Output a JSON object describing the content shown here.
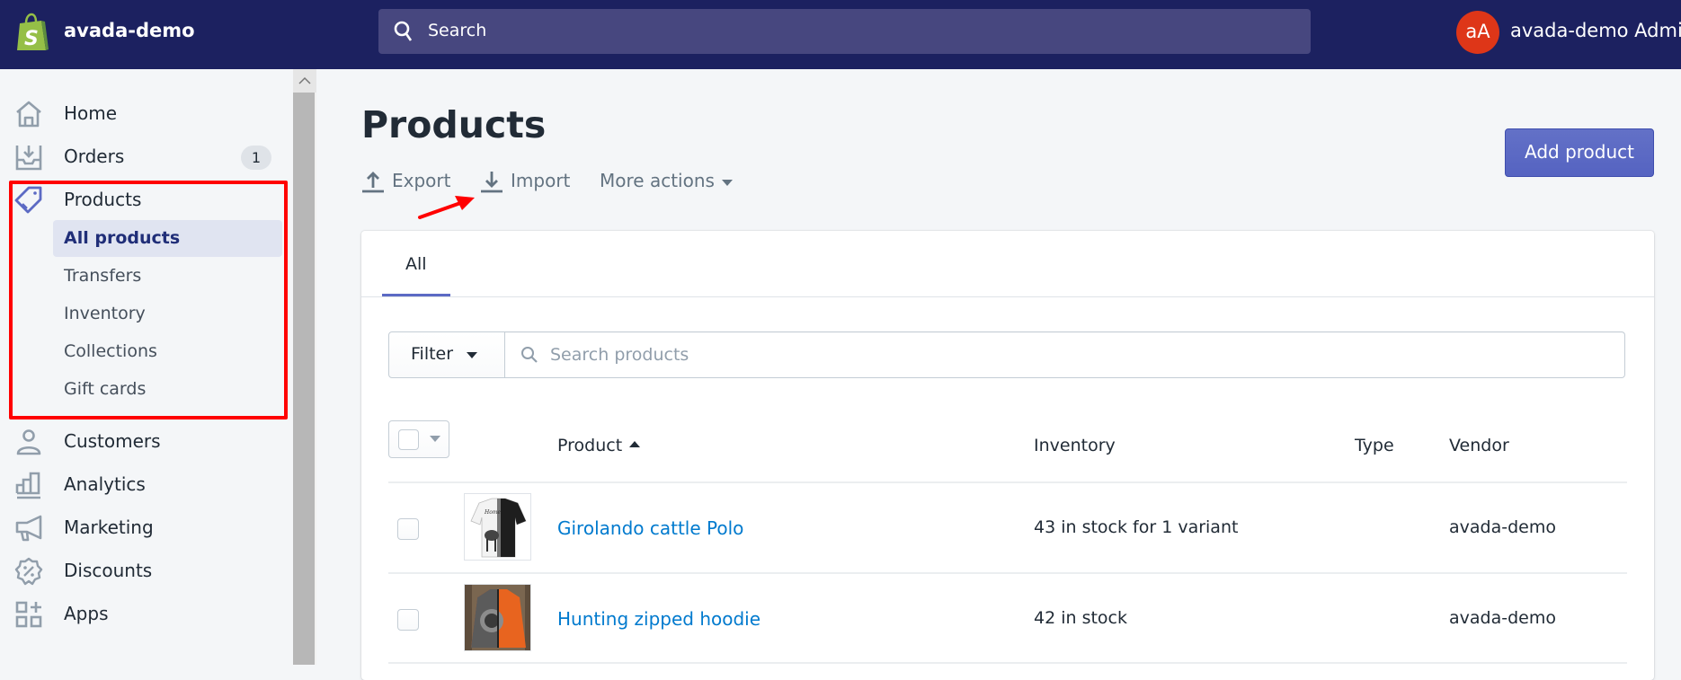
{
  "topbar": {
    "store_name": "avada-demo",
    "search_placeholder": "Search",
    "avatar_initials": "aA",
    "user_name": "avada-demo Admin",
    "colors": {
      "background": "#1c2160",
      "search_bg": "#47477f",
      "avatar": "#de3618"
    }
  },
  "sidebar": {
    "items": [
      {
        "label": "Home",
        "icon": "home-icon"
      },
      {
        "label": "Orders",
        "icon": "orders-icon",
        "badge": "1"
      },
      {
        "label": "Products",
        "icon": "tag-icon",
        "active": true
      },
      {
        "label": "Customers",
        "icon": "customer-icon"
      },
      {
        "label": "Analytics",
        "icon": "analytics-icon"
      },
      {
        "label": "Marketing",
        "icon": "megaphone-icon"
      },
      {
        "label": "Discounts",
        "icon": "discount-icon"
      },
      {
        "label": "Apps",
        "icon": "apps-icon"
      }
    ],
    "products_sub": [
      {
        "label": "All products",
        "active": true
      },
      {
        "label": "Transfers"
      },
      {
        "label": "Inventory"
      },
      {
        "label": "Collections"
      },
      {
        "label": "Gift cards"
      }
    ]
  },
  "page": {
    "title": "Products",
    "actions": {
      "export": "Export",
      "import": "Import",
      "more": "More actions"
    },
    "add_product": "Add product",
    "tabs": [
      {
        "label": "All",
        "selected": true
      }
    ],
    "filter_label": "Filter",
    "search_placeholder": "Search products",
    "table": {
      "columns": [
        "Product",
        "Inventory",
        "Type",
        "Vendor"
      ],
      "sort": {
        "column": "Product",
        "direction": "ascending"
      },
      "rows": [
        {
          "product": "Girolando cattle Polo",
          "inventory": "43 in stock for 1 variant",
          "type": "",
          "vendor": "avada-demo",
          "thumbnail": "polo-shirt-thumbnail"
        },
        {
          "product": "Hunting zipped hoodie",
          "inventory": "42 in stock",
          "type": "",
          "vendor": "avada-demo",
          "thumbnail": "hoodie-thumbnail"
        }
      ]
    }
  },
  "colors": {
    "accent": "#5c6ac4",
    "link": "#007ace",
    "annotation": "#ff0000"
  }
}
